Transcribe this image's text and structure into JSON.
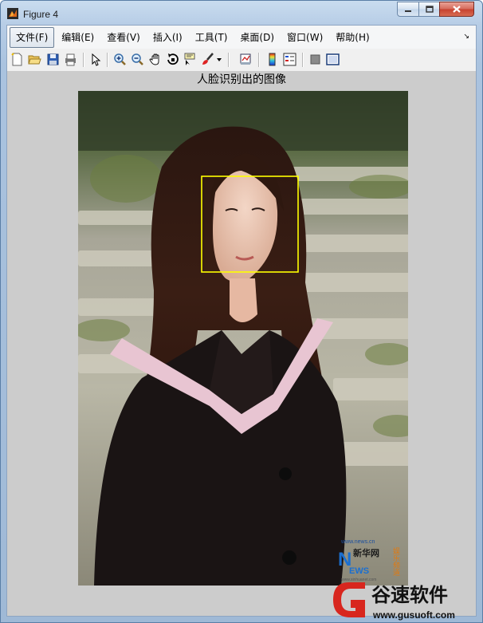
{
  "window": {
    "title": "Figure 4"
  },
  "menu": [
    {
      "label": "文件(F)"
    },
    {
      "label": "编辑(E)"
    },
    {
      "label": "查看(V)"
    },
    {
      "label": "插入(I)"
    },
    {
      "label": "工具(T)"
    },
    {
      "label": "桌面(D)"
    },
    {
      "label": "窗口(W)"
    },
    {
      "label": "帮助(H)"
    }
  ],
  "toolbar_icons": [
    "new-figure-icon",
    "open-file-icon",
    "save-icon",
    "print-icon",
    "edit-plot-icon",
    "zoom-in-icon",
    "zoom-out-icon",
    "pan-icon",
    "rotate-3d-icon",
    "data-cursor-icon",
    "brush-icon",
    "brush-dropdown-icon",
    "link-plot-icon",
    "colorbar-icon",
    "legend-icon",
    "hide-plot-tools-icon",
    "show-plot-tools-icon"
  ],
  "axes": {
    "title": "人脸识别出的图像"
  },
  "photo": {
    "description_id": "graduate-photo",
    "logo": {
      "line1": "www.news.cn",
      "brand_big": "N",
      "brand_rest": "EWS",
      "brand_cn": "新华网",
      "side": "娱乐频道",
      "sub": "www.xinhuanet.com"
    },
    "face_box_color": "#ffff00"
  },
  "watermark": {
    "cn": "谷速软件",
    "url": "www.gusuoft.com"
  }
}
